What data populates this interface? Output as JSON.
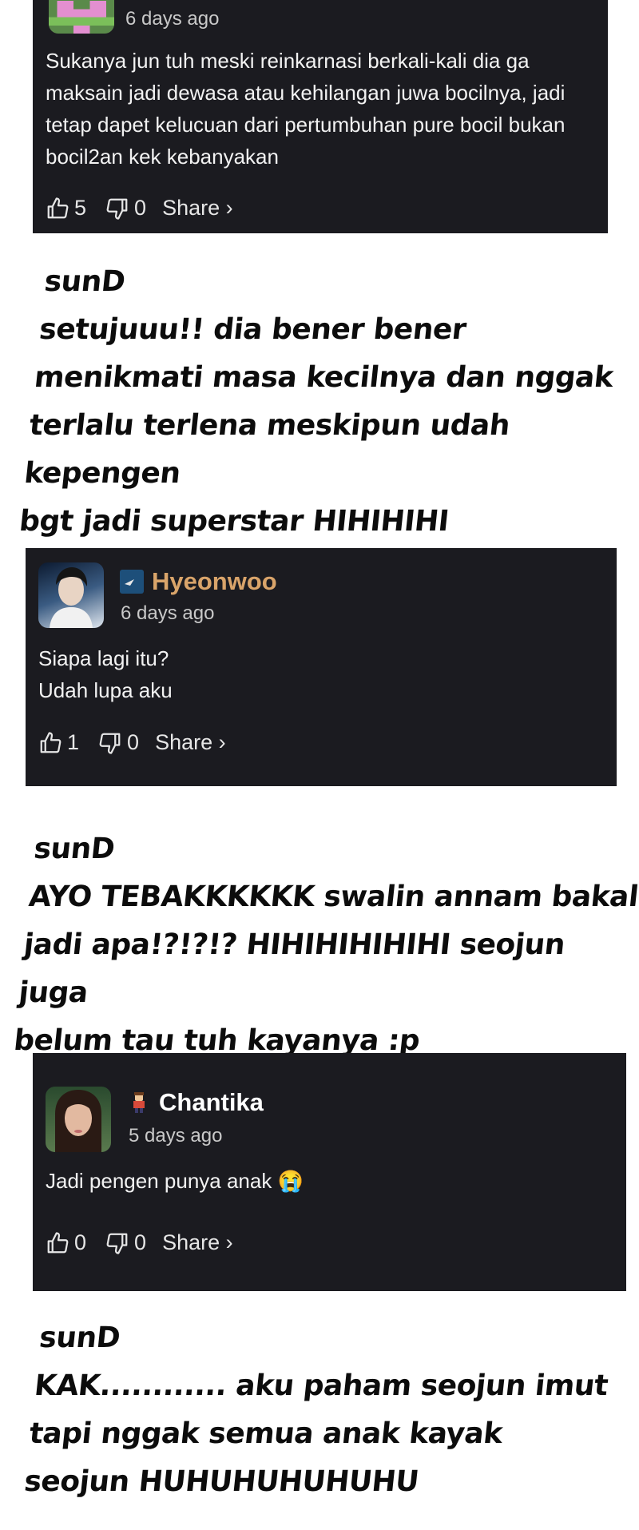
{
  "comments": [
    {
      "username": "",
      "time": "6 days ago",
      "text": "Sukanya jun tuh meski reinkarnasi berkali-kali dia ga maksain jadi dewasa atau kehilangan juwa bocilnya, jadi tetap dapet kelucuan dari pertumbuhan pure bocil bukan bocil2an kek kebanyakan",
      "likes": "5",
      "dislikes": "0",
      "share": "Share ›",
      "name_color": "#f0f0f0",
      "avatar_icon": "pixel-avatar-icon"
    },
    {
      "username": "Hyeonwoo",
      "time": "6 days ago",
      "text": "Siapa lagi itu?\nUdah lupa aku",
      "likes": "1",
      "dislikes": "0",
      "share": "Share ›",
      "name_color": "#d9a46a",
      "avatar_icon": "profile-photo-icon"
    },
    {
      "username": "Chantika",
      "time": "5 days ago",
      "text": "Jadi pengen punya anak 😭",
      "likes": "0",
      "dislikes": "0",
      "share": "Share ›",
      "name_color": "#ffffff",
      "avatar_icon": "profile-photo-icon"
    }
  ],
  "replies": [
    {
      "author": "sunD",
      "text": "setujuuu!! dia bener bener\nmenikmati masa kecilnya dan nggak\nterlalu terlena meskipun udah kepengen\nbgt jadi superstar HIHIHIHI"
    },
    {
      "author": "sunD",
      "text": "AYO TEBAKKKKKK swalin annam bakal\njadi apa!?!?!? HIHIHIHIHIHI seojun juga\nbelum tau tuh kayanya :p"
    },
    {
      "author": "sunD",
      "text": "KAK............ aku paham seojun imut\ntapi nggak semua anak kayak\nseojun HUHUHUHUHUHU"
    }
  ]
}
